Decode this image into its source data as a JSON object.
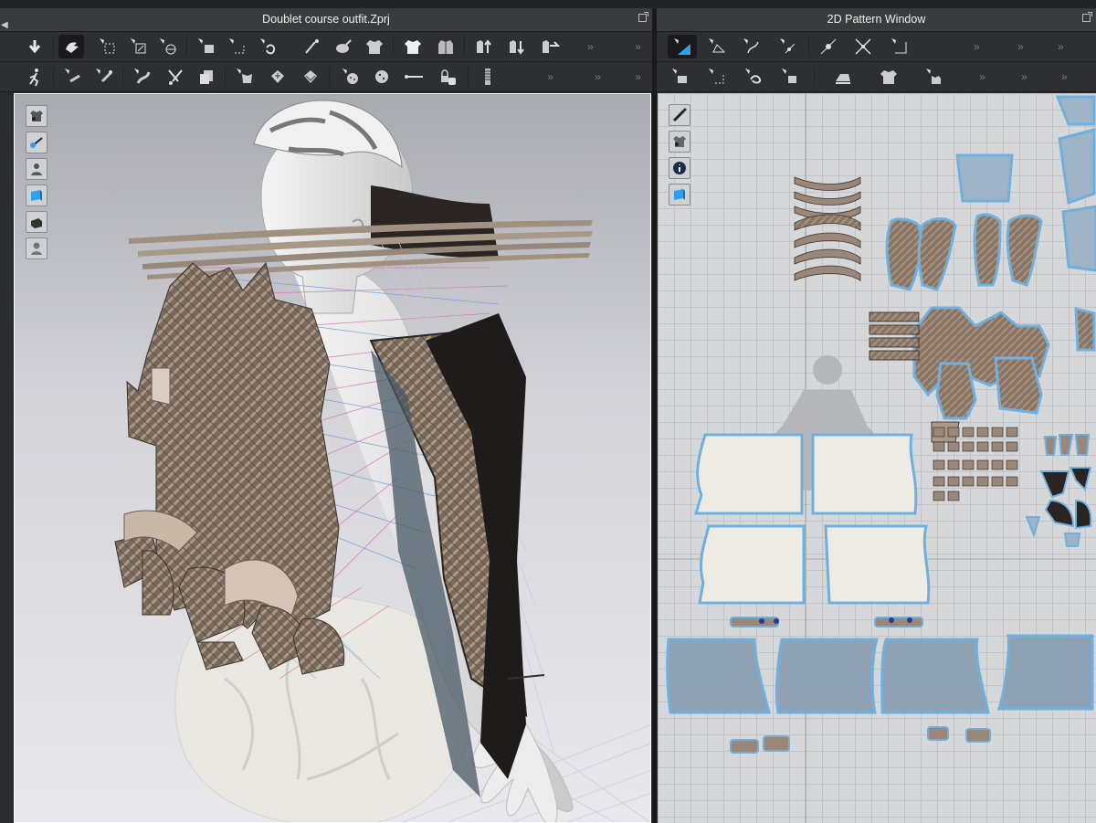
{
  "windows": {
    "left_title": "Doublet course outfit.Zprj",
    "right_title": "2D Pattern Window"
  },
  "toolbar_3d_row1": [
    "arrow-down-icon",
    "select-move-icon",
    "select-box-icon",
    "transform-icon",
    "fold-icon",
    "pin-icon",
    "gizmo-icon",
    "tack-icon",
    "pen-icon",
    "brush-icon",
    "garment-icon",
    "garment-front-icon",
    "garment-back-icon",
    "garment-up-icon",
    "garment-sort-icon",
    "garment-stack-icon"
  ],
  "toolbar_3d_row2": [
    "avatar-pose-icon",
    "measure-icon",
    "pin-tool-icon",
    "arrangement-icon",
    "cut-icon",
    "copy-icon",
    "button-tool-icon",
    "zipper-icon",
    "texture-icon",
    "button-icon",
    "buttonhole-icon",
    "topstitch-icon",
    "lock-icon",
    "zipper-pull-icon"
  ],
  "toolbar_2d_row1": [
    "pattern-edit-icon",
    "transform-pattern-icon",
    "curve-point-icon",
    "edit-curvature-icon",
    "add-point-icon",
    "split-icon",
    "polygon-icon"
  ],
  "toolbar_2d_row2": [
    "segment-sewing-icon",
    "free-sewing-icon",
    "curve-sewing-icon",
    "sewing-edit-icon",
    "iron-icon",
    "fold-pattern-icon",
    "trace-icon"
  ],
  "side_tools_3d": [
    "garment-view-icon",
    "avatar-view-icon",
    "avatar-display-icon",
    "fabric-view-icon",
    "solid-icon",
    "avatar-silhouette-icon"
  ],
  "side_tools_2d": [
    "draw-pen-icon",
    "show-garment-icon",
    "info-icon",
    "texture-view-icon"
  ],
  "more_glyph": "»"
}
